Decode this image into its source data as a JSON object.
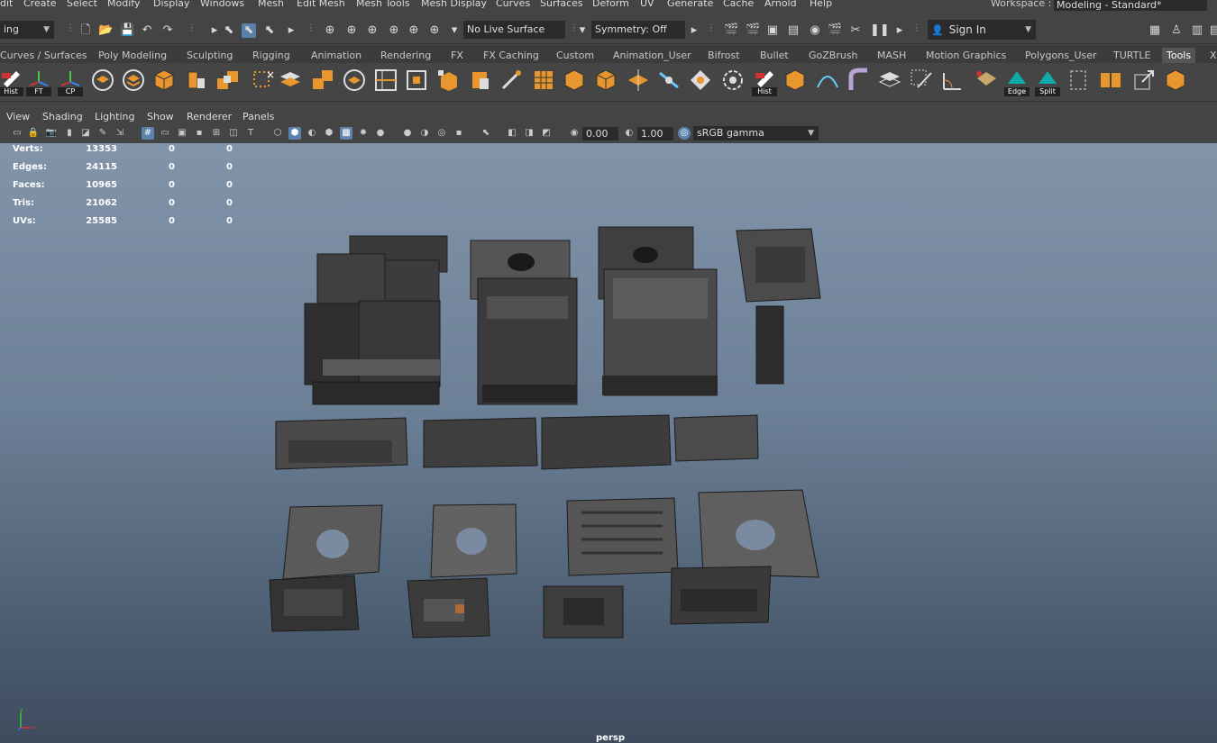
{
  "menu": [
    "dit",
    "Create",
    "Select",
    "Modify",
    "Display",
    "Windows",
    "Mesh",
    "Edit Mesh",
    "Mesh Tools",
    "Mesh Display",
    "Curves",
    "Surfaces",
    "Deform",
    "UV",
    "Generate",
    "Cache",
    "Arnold",
    "Help"
  ],
  "workspace": {
    "label": "Workspace :",
    "value": "Modeling - Standard*"
  },
  "status": {
    "mode_value": "ing",
    "live_surface": "No Live Surface",
    "symmetry": "Symmetry: Off",
    "sign_in": "Sign In"
  },
  "shelf_tabs": [
    "Curves / Surfaces",
    "Poly Modeling",
    "Sculpting",
    "Rigging",
    "Animation",
    "Rendering",
    "FX",
    "FX Caching",
    "Custom",
    "Animation_User",
    "Bifrost",
    "Bullet",
    "GoZBrush",
    "MASH",
    "Motion Graphics",
    "Polygons_User",
    "TURTLE",
    "Tools",
    "X"
  ],
  "shelf_active": "Tools",
  "shelf_labels": {
    "hist": "Hist",
    "ft": "FT",
    "cp": "CP",
    "hist2": "Hist",
    "edge": "Edge",
    "split": "Split"
  },
  "panel_menu": [
    "View",
    "Shading",
    "Lighting",
    "Show",
    "Renderer",
    "Panels"
  ],
  "panel_tools": {
    "exposure": "0.00",
    "gamma": "1.00",
    "colorspace": "sRGB gamma"
  },
  "hud": [
    {
      "label": "Verts:",
      "v1": "13353",
      "v2": "0",
      "v3": "0"
    },
    {
      "label": "Edges:",
      "v1": "24115",
      "v2": "0",
      "v3": "0"
    },
    {
      "label": "Faces:",
      "v1": "10965",
      "v2": "0",
      "v3": "0"
    },
    {
      "label": "Tris:",
      "v1": "21062",
      "v2": "0",
      "v3": "0"
    },
    {
      "label": "UVs:",
      "v1": "25585",
      "v2": "0",
      "v3": "0"
    }
  ],
  "camera": "persp",
  "colors": {
    "viewport_top": "#8294aa",
    "viewport_bottom": "#3d4b5d",
    "accent": "#5a7fa8",
    "shelf_orange": "#e8962e"
  }
}
